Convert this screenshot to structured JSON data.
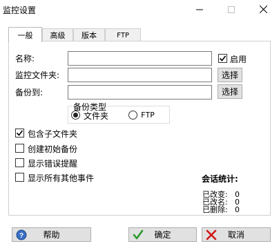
{
  "window": {
    "title": "监控设置",
    "minimize_icon": "minimize-icon",
    "maximize_icon": "maximize-icon",
    "close_icon": "close-icon"
  },
  "tabs": [
    {
      "label": "一般",
      "active": true
    },
    {
      "label": "高级",
      "active": false
    },
    {
      "label": "版本",
      "active": false
    },
    {
      "label": "FTP",
      "active": false
    }
  ],
  "general": {
    "name_label": "名称:",
    "name_value": "",
    "enable_label": "启用",
    "enable_checked": true,
    "folder_label": "监控文件夹:",
    "folder_value": "",
    "folder_browse": "选择",
    "backup_label": "备份到:",
    "backup_value": "",
    "backup_browse": "选择",
    "backup_type": {
      "legend": "备份类型",
      "options": [
        {
          "label": "文件夹",
          "selected": true
        },
        {
          "label": "FTP",
          "selected": false
        }
      ]
    },
    "options": [
      {
        "label": "包含子文件夹",
        "checked": true
      },
      {
        "label": "创建初始备份",
        "checked": false
      },
      {
        "label": "显示错误提醒",
        "checked": false
      },
      {
        "label": "显示所有其他事件",
        "checked": false
      }
    ]
  },
  "session_stats": {
    "title": "会话统计:",
    "rows": [
      {
        "label": "已改变:",
        "value": "0"
      },
      {
        "label": "已改名:",
        "value": "0"
      },
      {
        "label": "已删除:",
        "value": "0"
      }
    ]
  },
  "buttons": {
    "help": "帮助",
    "ok": "确定",
    "cancel": "取消"
  },
  "colors": {
    "ok_check": "#2a9a2a",
    "cancel_x": "#d01818",
    "help_icon": "#3a6fc4"
  }
}
